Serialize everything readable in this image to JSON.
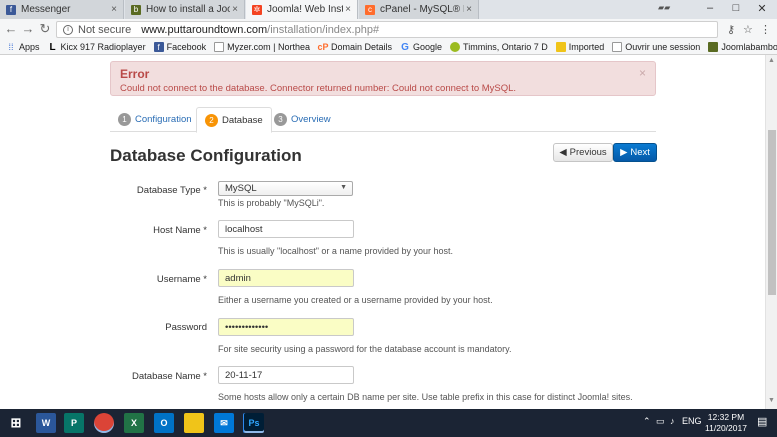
{
  "browser": {
    "tabs": [
      {
        "title": "Messenger",
        "icon": "facebook-icon",
        "icon_color": "#3b5998",
        "active": false
      },
      {
        "title": "How to install a Joomla",
        "icon": "bookmark-icon",
        "icon_color": "#5a6b22",
        "active": false
      },
      {
        "title": "Joomla! Web Installer",
        "icon": "joomla-icon",
        "icon_color": "#f44321",
        "active": true
      },
      {
        "title": "cPanel - MySQL® Datab",
        "icon": "cpanel-icon",
        "icon_color": "#ff6c2c",
        "active": false
      }
    ],
    "tab_close": "×",
    "minimize": "–",
    "maximize": "□",
    "close": "✕",
    "address": {
      "security": "Not secure",
      "host": "www.puttaroundtown.com",
      "path": "/installation/index.php#"
    },
    "bookmarks": [
      {
        "label": "Apps",
        "icon": "apps-grid-icon"
      },
      {
        "label": "Kicx 917 Radioplayer",
        "icon": "radio-icon"
      },
      {
        "label": "Facebook",
        "icon": "facebook-icon"
      },
      {
        "label": "Myzer.com | Northea",
        "icon": "myzer-icon"
      },
      {
        "label": "Domain Details",
        "icon": "cpanel-icon"
      },
      {
        "label": "Google",
        "icon": "google-icon"
      },
      {
        "label": "Timmins, Ontario 7 D",
        "icon": "weather-icon"
      },
      {
        "label": "Imported",
        "icon": "folder-icon"
      },
      {
        "label": "Ouvrir une session",
        "icon": "page-icon"
      },
      {
        "label": "Joomlabamboo Supp",
        "icon": "bookmark-icon"
      }
    ],
    "more_bookmarks": "»"
  },
  "alert": {
    "title": "Error",
    "message": "Could not connect to the database. Connector returned number: Could not connect to MySQL.",
    "close": "×"
  },
  "steps": [
    {
      "num": "1",
      "label": "Configuration"
    },
    {
      "num": "2",
      "label": "Database"
    },
    {
      "num": "3",
      "label": "Overview"
    }
  ],
  "heading": "Database Configuration",
  "buttons": {
    "previous": "Previous",
    "next": "Next"
  },
  "form": {
    "db_type": {
      "label": "Database Type *",
      "value": "MySQL",
      "help": "This is probably \"MySQLi\"."
    },
    "host_name": {
      "label": "Host Name *",
      "value": "localhost",
      "help": "This is usually \"localhost\" or a name provided by your host."
    },
    "username": {
      "label": "Username *",
      "value": "admin",
      "help": "Either a username you created or a username provided by your host."
    },
    "password": {
      "label": "Password",
      "value": "•••••••••••••",
      "help": "For site security using a password for the database account is mandatory."
    },
    "db_name": {
      "label": "Database Name *",
      "value": "20-11-17",
      "help": "Some hosts allow only a certain DB name per site. Use table prefix in this case for distinct Joomla! sites."
    }
  },
  "taskbar": {
    "apps": [
      {
        "label": "W",
        "icon": "word-icon",
        "color": "#2b579a"
      },
      {
        "label": "P",
        "icon": "publisher-icon",
        "color": "#077568"
      },
      {
        "label": "",
        "icon": "chrome-icon",
        "color": "#db4437"
      },
      {
        "label": "X",
        "icon": "excel-icon",
        "color": "#217346"
      },
      {
        "label": "O",
        "icon": "outlook-icon",
        "color": "#0072c6"
      },
      {
        "label": "",
        "icon": "file-explorer-icon",
        "color": "#f0c419"
      },
      {
        "label": "",
        "icon": "mail-icon",
        "color": "#0078d7"
      },
      {
        "label": "",
        "icon": "pictures-icon",
        "color": "#2d89ef"
      },
      {
        "label": "Ps",
        "icon": "photoshop-icon",
        "color": "#001e36"
      }
    ],
    "language": "ENG",
    "time": "12:32 PM",
    "date": "11/20/2017"
  }
}
